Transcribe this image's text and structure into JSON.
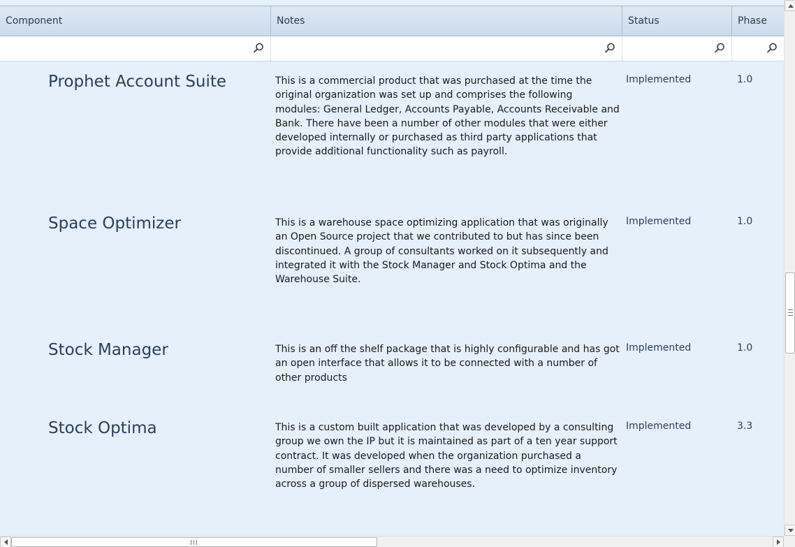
{
  "columns": [
    {
      "label": "Component"
    },
    {
      "label": "Notes"
    },
    {
      "label": "Status"
    },
    {
      "label": "Phase"
    }
  ],
  "filters": {
    "component": {
      "value": "",
      "placeholder": ""
    },
    "notes": {
      "value": "",
      "placeholder": ""
    },
    "status": {
      "value": "",
      "placeholder": ""
    },
    "phase": {
      "value": "",
      "placeholder": ""
    }
  },
  "rows": [
    {
      "component": "Prophet Account Suite",
      "notes": "This is a commercial product that was purchased at the time the original organization was set up and comprises the following modules: General Ledger, Accounts Payable, Accounts Receivable and Bank. There have been a number of other modules that were either developed internally or purchased as third party applications that provide additional functionality such as payroll.",
      "status": "Implemented",
      "phase": "1.0"
    },
    {
      "component": "Space Optimizer",
      "notes": "This is a warehouse space optimizing application that was originally an Open Source project that we contributed to but has since been discontinued. A group of consultants worked on it subsequently and integrated it with the Stock Manager and Stock Optima and the Warehouse Suite.",
      "status": "Implemented",
      "phase": "1.0"
    },
    {
      "component": "Stock Manager",
      "notes": "This is an off the shelf package that is highly configurable and has got an open interface that allows it to be connected with a number of other products",
      "status": "Implemented",
      "phase": "1.0"
    },
    {
      "component": "Stock Optima",
      "notes": "This is a custom built application that was developed by a consulting group we own the IP but it is maintained as part of a ten year support contract. It was developed when the organization purchased a number of smaller sellers and there was a need to optimize inventory across a group of dispersed warehouses.",
      "status": "Implemented",
      "phase": "3.3"
    }
  ],
  "icons": {
    "filter": "magnifier-icon",
    "scroll_up": "arrow-up-icon",
    "scroll_down": "arrow-down-icon",
    "scroll_left": "arrow-left-icon",
    "scroll_right": "arrow-right-icon"
  },
  "colors": {
    "header_bg": "#d3e0ef",
    "row_bg": "#e6f0fa",
    "filter_bg": "#ffffff",
    "component_text": "#2a3f5c"
  }
}
